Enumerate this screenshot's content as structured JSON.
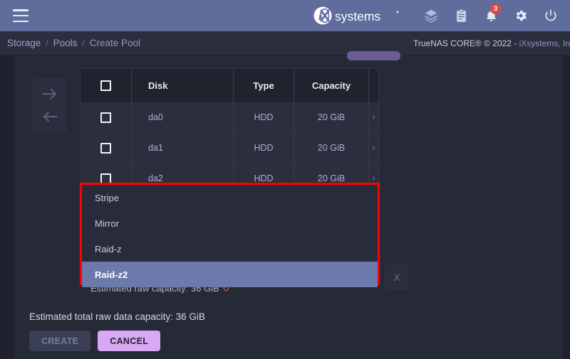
{
  "topbar": {
    "menu_label": "Menu",
    "brand": "iXsystems",
    "icons": [
      {
        "name": "tasks-icon",
        "glyph": "layers"
      },
      {
        "name": "clipboard-icon",
        "glyph": "clipboard"
      },
      {
        "name": "notifications-icon",
        "glyph": "bell",
        "badge": "3"
      },
      {
        "name": "settings-icon",
        "glyph": "gear"
      },
      {
        "name": "power-icon",
        "glyph": "power"
      }
    ]
  },
  "breadcrumb": {
    "items": [
      "Storage",
      "Pools",
      "Create Pool"
    ],
    "separator": "/"
  },
  "copyright": {
    "prefix": "TrueNAS CORE® © 2022 - ",
    "link": "iXsystems, In"
  },
  "transfer": {
    "forward_label": "→",
    "back_label": "←"
  },
  "disk_table": {
    "columns": [
      "",
      "Disk",
      "Type",
      "Capacity",
      ""
    ],
    "rows": [
      {
        "disk": "da0",
        "type": "HDD",
        "capacity": "20 GiB",
        "chevron": "›"
      },
      {
        "disk": "da1",
        "type": "HDD",
        "capacity": "20 GiB",
        "chevron": "›"
      },
      {
        "disk": "da2",
        "type": "HDD",
        "capacity": "20 GiB",
        "chevron": "›"
      },
      {
        "disk": "",
        "type": "",
        "capacity": "",
        "chevron": "›"
      }
    ]
  },
  "dropdown": {
    "options": [
      "Stripe",
      "Mirror",
      "Raid-z",
      "Raid-z2"
    ],
    "selected": "Raid-z2",
    "highlight_color": "#6c79ab",
    "outline_color": "#fe0000"
  },
  "capacity": {
    "raw": "Estimated raw capacity: 36 GiB",
    "refresh_icon": "↻",
    "total": "Estimated total raw data capacity: 36 GiB"
  },
  "actions": {
    "create": "CREATE",
    "cancel": "CANCEL",
    "remove_vdev": "X"
  }
}
